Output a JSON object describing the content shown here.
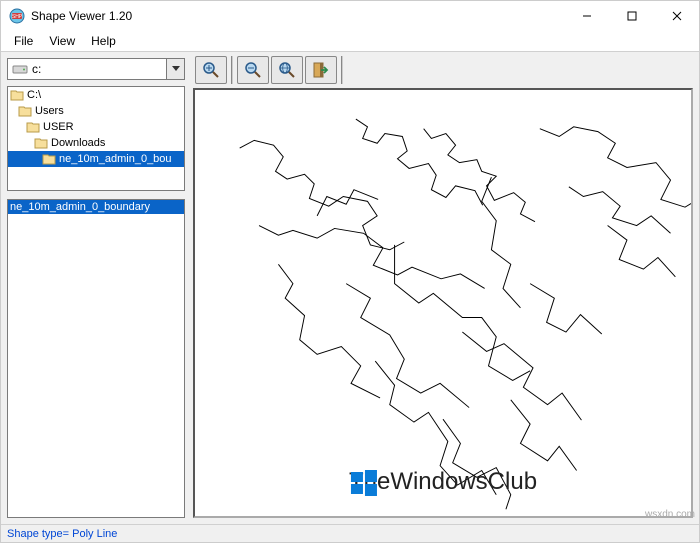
{
  "window": {
    "title": "Shape Viewer 1.20"
  },
  "menu": {
    "file": "File",
    "view": "View",
    "help": "Help"
  },
  "drive": {
    "label": "c:"
  },
  "tree": {
    "root": "C:\\",
    "users": "Users",
    "user": "USER",
    "downloads": "Downloads",
    "selected": "ne_10m_admin_0_bou"
  },
  "list": {
    "item0": "ne_10m_admin_0_boundary"
  },
  "status": {
    "text": "Shape type= Poly Line"
  },
  "watermark": {
    "text": "TheWindowsClub"
  },
  "credit": {
    "text": "wsxdn.com"
  }
}
